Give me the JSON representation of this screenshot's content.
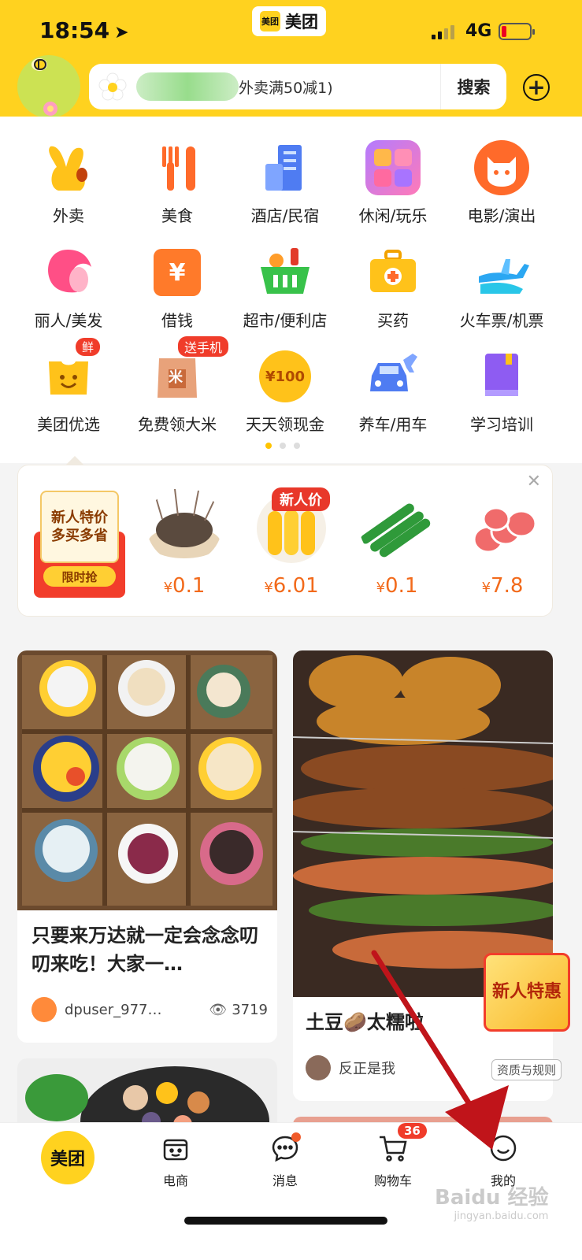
{
  "status_bar": {
    "time": "18:54",
    "network": "4G"
  },
  "app_badge": {
    "logo": "美团",
    "name": "美团"
  },
  "search": {
    "text": "外卖满50减1)",
    "button": "搜索"
  },
  "categories": [
    {
      "label": "外卖",
      "icon": "waimai-icon"
    },
    {
      "label": "美食",
      "icon": "fork-knife-icon"
    },
    {
      "label": "酒店/民宿",
      "icon": "hotel-icon"
    },
    {
      "label": "休闲/玩乐",
      "icon": "leisure-icon"
    },
    {
      "label": "电影/演出",
      "icon": "movie-cat-icon"
    },
    {
      "label": "丽人/美发",
      "icon": "beauty-icon"
    },
    {
      "label": "借钱",
      "icon": "loan-icon",
      "glyph": "¥"
    },
    {
      "label": "超市/便利店",
      "icon": "supermarket-icon"
    },
    {
      "label": "买药",
      "icon": "medicine-icon"
    },
    {
      "label": "火车票/机票",
      "icon": "plane-icon"
    },
    {
      "label": "美团优选",
      "icon": "youxuan-icon",
      "badge": "鲜"
    },
    {
      "label": "免费领大米",
      "icon": "rice-bag-icon",
      "badge": "送手机",
      "glyph": "米"
    },
    {
      "label": "天天领现金",
      "icon": "coin-icon",
      "glyph": "¥100"
    },
    {
      "label": "养车/用车",
      "icon": "car-icon"
    },
    {
      "label": "学习培训",
      "icon": "book-icon"
    }
  ],
  "new_user": {
    "gift_line1": "新人特价",
    "gift_line2": "多买多省",
    "gift_button": "限时抢",
    "badge": "新人价",
    "currency": "¥",
    "items": [
      {
        "name": "shrimp",
        "price": "0.1"
      },
      {
        "name": "corn",
        "price": "6.01"
      },
      {
        "name": "cucumber",
        "price": "0.1"
      },
      {
        "name": "beef-roll",
        "price": "7.8"
      }
    ]
  },
  "feed": [
    {
      "title": "只要来万达就一定会念念叨叨来吃！大家一…",
      "author": "dpuser_977…",
      "views": "3719"
    },
    {
      "title": "土豆🥔太糯啦",
      "author": "反正是我"
    }
  ],
  "promo": {
    "text": "新人特惠"
  },
  "rules_tag": "资质与规则",
  "tabs": [
    {
      "label": "美团"
    },
    {
      "label": "电商"
    },
    {
      "label": "消息"
    },
    {
      "label": "购物车",
      "count": "36"
    },
    {
      "label": "我的"
    }
  ],
  "watermark": {
    "main": "Baidu 经验",
    "sub": "jingyan.baidu.com"
  },
  "colors": {
    "brand_yellow": "#ffd21f",
    "price_orange": "#f26a1b",
    "badge_red": "#f03c2a",
    "arrow_red": "#c0141a"
  }
}
